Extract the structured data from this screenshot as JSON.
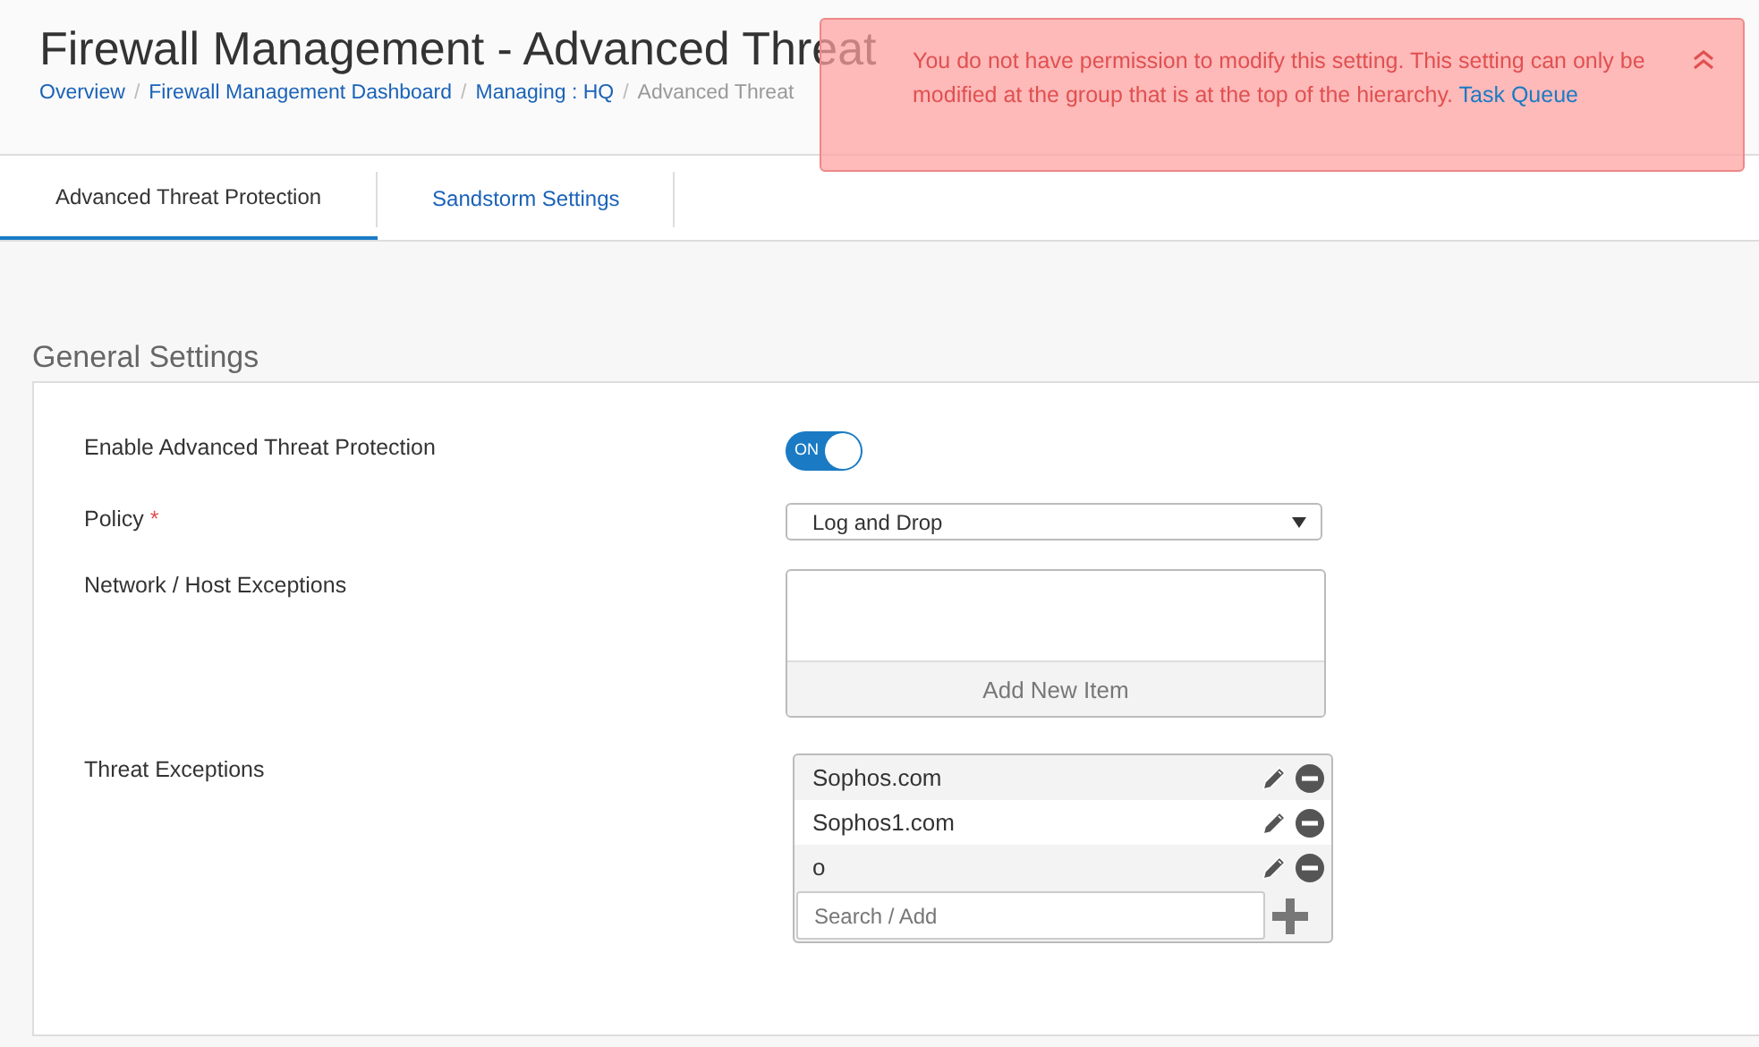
{
  "header": {
    "title": "Firewall Management - Advanced Threat",
    "breadcrumbs": [
      {
        "label": "Overview",
        "link": true
      },
      {
        "separator": "/",
        "label": "Firewall Management Dashboard",
        "link": true
      },
      {
        "separator": "/",
        "label": "Managing : HQ",
        "link": true
      },
      {
        "separator": "/",
        "label": "Advanced Threat",
        "link": false
      }
    ]
  },
  "alert": {
    "message": "You do not have permission to modify this setting. This setting can only be modified at the group that is at the top of the hierarchy.",
    "link": "Task Queue"
  },
  "tabs": [
    {
      "label": "Advanced Threat Protection",
      "selected": true
    },
    {
      "label": "Sandstorm Settings",
      "selected": false
    }
  ],
  "section": {
    "title": "General Settings",
    "fields": [
      {
        "kind": "toggle",
        "label": "Enable Advanced Threat Protection",
        "on": true,
        "state_label": "ON"
      },
      {
        "kind": "select",
        "label": "Policy",
        "required_mark": "*",
        "value": "Log and Drop"
      },
      {
        "kind": "item-list",
        "label": "Network / Host Exceptions",
        "add_button": "Add New Item"
      },
      {
        "kind": "tag-list",
        "label": "Threat Exceptions",
        "items": [
          "Sophos.com",
          "Sophos1.com",
          "o"
        ],
        "placeholder": "Search / Add"
      }
    ]
  }
}
